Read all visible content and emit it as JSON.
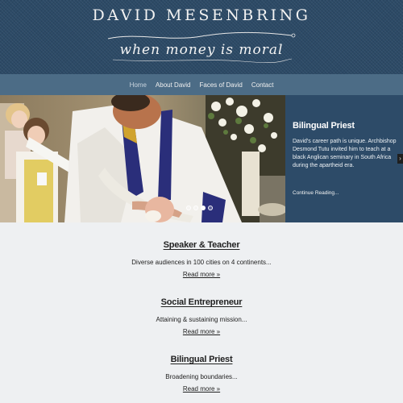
{
  "header": {
    "site_title": "DAVID MESENBRING",
    "tagline": "when money is moral"
  },
  "nav": {
    "items": [
      {
        "label": "Home",
        "active": true
      },
      {
        "label": "About David",
        "active": false
      },
      {
        "label": "Faces of David",
        "active": false
      },
      {
        "label": "Contact",
        "active": false
      }
    ]
  },
  "slider": {
    "caption_title": "Bilingual Priest",
    "caption_text": "David's career path is unique. Archbishop Desmond Tutu invited him to teach at a black Anglican seminary in South Africa during the apartheid era.",
    "caption_link": "Continue Reading...",
    "next_arrow": "›",
    "dot_count": 4,
    "active_dot": 2
  },
  "features": [
    {
      "title": "Speaker & Teacher",
      "text": "Diverse audiences in 100 cities on 4 continents...",
      "link": "Read more »"
    },
    {
      "title": "Social Entrepreneur",
      "text": "Attaining & sustaining mission...",
      "link": "Read more »"
    },
    {
      "title": "Bilingual Priest",
      "text": "Broadening boundaries...",
      "link": "Read more »"
    }
  ],
  "colors": {
    "header_bg": "#2c4a66",
    "nav_bg": "#4c6c86",
    "caption_bg": "#2d4b68",
    "page_bg": "#eef0f2"
  }
}
